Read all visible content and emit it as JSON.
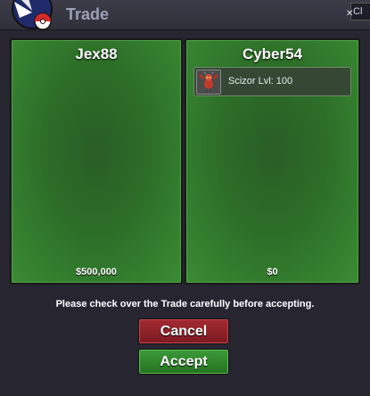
{
  "window": {
    "title": "Trade"
  },
  "chat_tab": {
    "label": "Cl"
  },
  "left_panel": {
    "player": "Jex88",
    "money": "$500,000"
  },
  "right_panel": {
    "player": "Cyber54",
    "money": "$0",
    "items": [
      {
        "name": "Scizor",
        "level": "Lvl: 100",
        "icon": "scizor-sprite-icon"
      }
    ]
  },
  "notice": "Please check over the Trade carefully before accepting.",
  "buttons": {
    "cancel": "Cancel",
    "accept": "Accept"
  },
  "colors": {
    "cancel": "#8f222a",
    "accept": "#2f8a2c",
    "panel": "#2c6e28"
  }
}
